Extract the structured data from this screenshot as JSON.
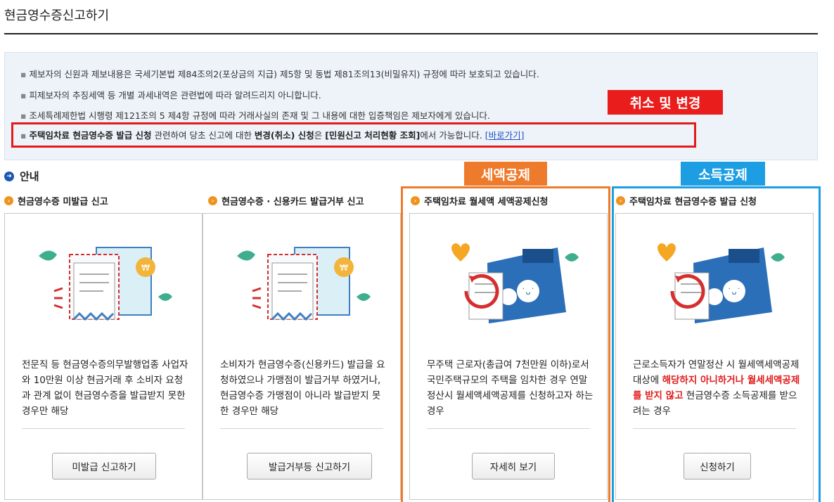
{
  "page_title": "현금영수증신고하기",
  "notices": [
    "제보자의 신원과 제보내용은 국세기본법 제84조의2(포상금의 지급) 제5항 및 동법 제81조의13(비밀유지) 규정에 따라 보호되고 있습니다.",
    "피제보자의 추징세액 등 개별 과세내역은 관련법에 따라 알려드리지 아니합니다.",
    "조세특례제한법 시행령 제121조의 5 제4항 규정에 따라 거래사실의 존재 및 그 내용에 대한 입증책임은 제보자에게 있습니다."
  ],
  "highlight_notice": {
    "part1": "주택임차료 현금영수증 발급 신청",
    "part2": " 관련하여 당초 신고에 대한 ",
    "part3": "변경(취소) 신청",
    "part4": "은 ",
    "part5": "[민원신고 처리현황 조회]",
    "part6": "에서 가능합니다. ",
    "link": "[바로가기]"
  },
  "tags": {
    "cancel": "취소 및 변경",
    "tax_credit": "세액공제",
    "income_deduction": "소득공제"
  },
  "guide_heading": "안내",
  "cards": [
    {
      "title": "현금영수증 미발급 신고",
      "description": "전문직 등 현금영수증의무발행업종 사업자와 10만원 이상 현금거래 후 소비자 요청과 관계 없이 현금영수증을 발급받지 못한 경우만 해당",
      "button": "미발급 신고하기"
    },
    {
      "title": "현금영수증 · 신용카드 발급거부 신고",
      "description": "소비자가 현금영수증(신용카드) 발급을 요청하였으나 가맹점이 발급거부 하였거나, 현금영수증 가맹점이 아니라 발급받지 못한 경우만 해당",
      "button": "발급거부등 신고하기"
    },
    {
      "title": "주택임차료 월세액 세액공제신청",
      "description": "무주택 근로자(총급여 7천만원 이하)로서 국민주택규모의 주택을 임차한 경우 연말정산시 월세액세액공제를 신청하고자 하는 경우",
      "button": "자세히 보기"
    },
    {
      "title": "주택임차료 현금영수증 발급 신청",
      "description_part1": "근로소득자가 연말정산 시 월세액세액공제 대상에 ",
      "description_red": "해당하지 아니하거나 월세세액공제를 받지 않고",
      "description_part2": " 현금영수증 소득공제를 받으려는 경우",
      "button": "신청하기"
    }
  ],
  "colors": {
    "highlight_red": "#e21b1b",
    "tax_orange": "#ee7a2b",
    "income_blue": "#1d9ee3",
    "notice_bg": "#eef3fa"
  }
}
